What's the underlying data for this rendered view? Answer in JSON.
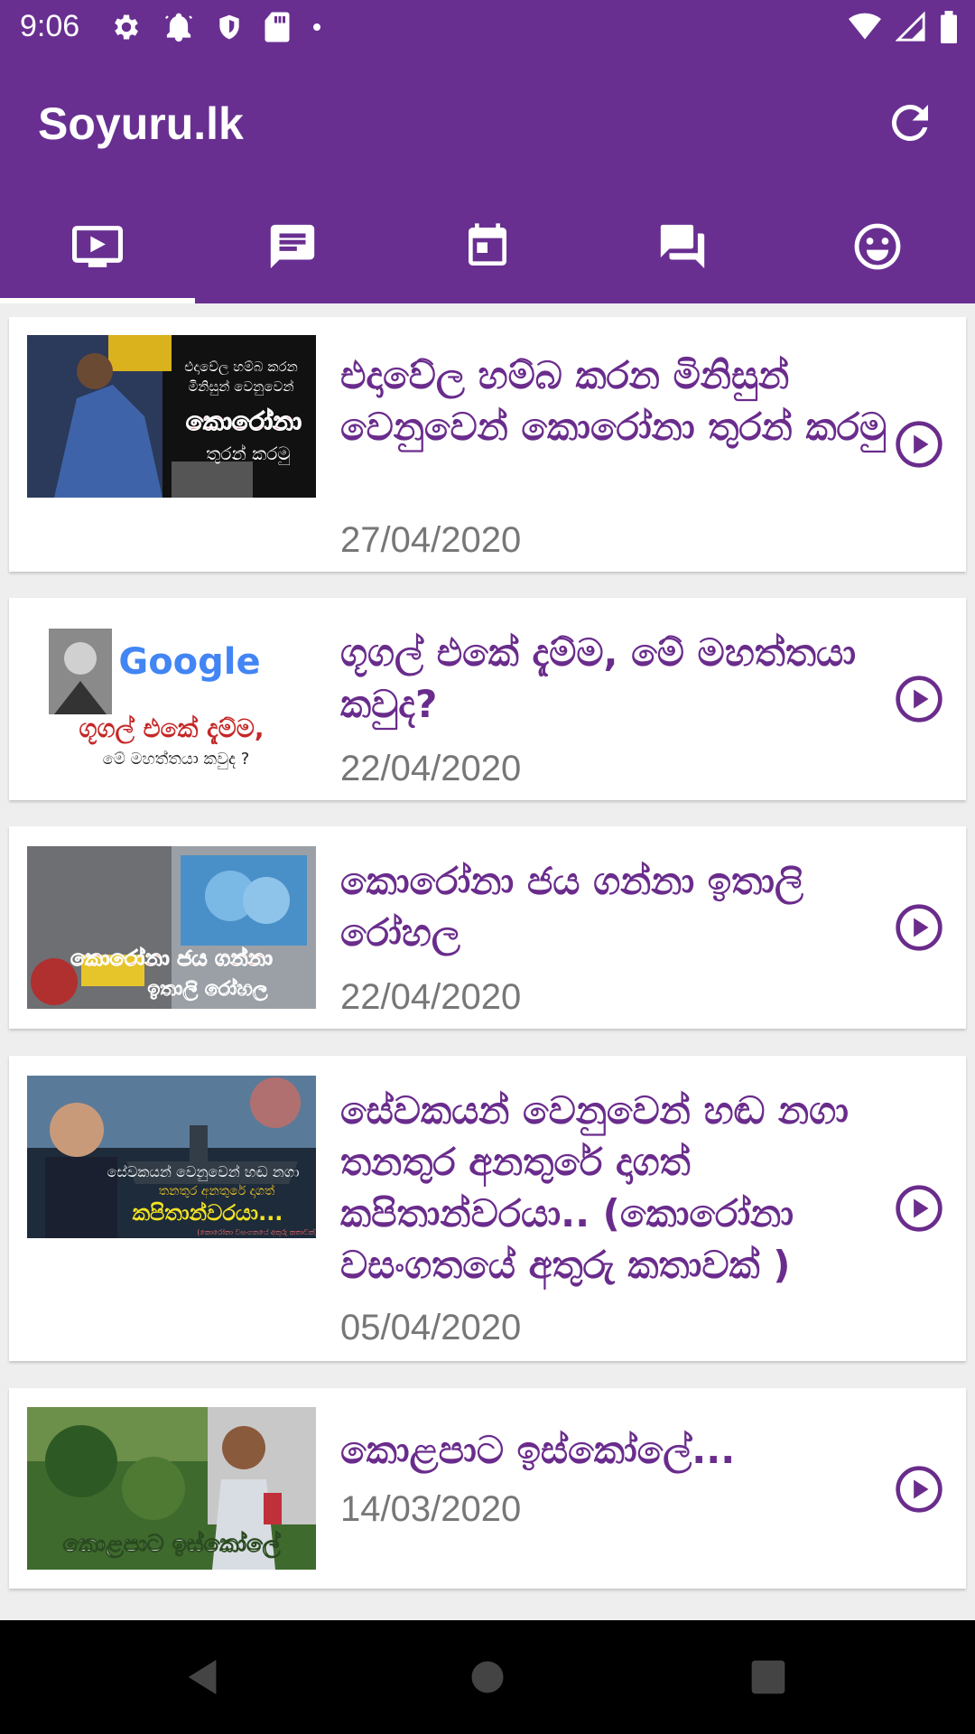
{
  "status": {
    "time": "9:06",
    "left_icons": [
      "settings-icon",
      "alarm-icon",
      "shield-icon",
      "sd-card-icon",
      "dot-icon"
    ],
    "right_icons": [
      "wifi-icon",
      "signal-icon",
      "battery-icon"
    ]
  },
  "app": {
    "title": "Soyuru.lk",
    "refresh_icon": "refresh-icon"
  },
  "tabs": [
    {
      "icon": "video-tab-icon",
      "selected": true
    },
    {
      "icon": "message-tab-icon",
      "selected": false
    },
    {
      "icon": "calendar-tab-icon",
      "selected": false
    },
    {
      "icon": "forum-tab-icon",
      "selected": false
    },
    {
      "icon": "smiley-tab-icon",
      "selected": false
    }
  ],
  "articles": [
    {
      "title": "එදාවේල හම්බ කරන මිනිසුන් වෙනුවෙන් කොරෝනා තුරන් කරමු",
      "date": "27/04/2020",
      "thumb_text": [
        "එදාවේල හම්බ කරන",
        "මිනිසුන් වෙනුවෙන්",
        "කොරෝනා",
        "තුරන් කරමු"
      ]
    },
    {
      "title": "ගූගල් එකේ දැම්ම, මේ මහත්තයා කවුද?",
      "date": "22/04/2020",
      "thumb_text": [
        "Google",
        "ගූගල් එකේ දැම්ම,",
        "මේ මහත්තයා කවුද ?"
      ]
    },
    {
      "title": "කොරෝනා ජය ගන්නා ඉතාලි රෝහල",
      "date": "22/04/2020",
      "thumb_text": [
        "කොරෝනා ජය ගන්නා",
        "ඉතාලි රෝහල"
      ]
    },
    {
      "title": "සේවකයන් වෙනුවෙන් හඬ නගා තනතුර අනතුරේ දාගත් කපිතාන්වරයා.. (කොරෝනා වසංගතයේ අතුරු කතාවක් )",
      "date": "05/04/2020",
      "thumb_text": [
        "සේවකයන් වෙනුවෙන් හඬ නගා",
        "තනතුර අනතුරේ දාගත්",
        "කපිතාන්වරයා...",
        "(කොරෝනා වසංගතයේ අතුරු කතාවක්)"
      ]
    },
    {
      "title": "කොළපාට ඉස්කෝලේ...",
      "date": "14/03/2020",
      "thumb_text": [
        "කොළපාට ඉස්කෝලේ"
      ]
    }
  ],
  "colors": {
    "primary": "#682f91",
    "title_text": "#6a2c8c",
    "date_text": "#777777",
    "background": "#eeeeee"
  }
}
